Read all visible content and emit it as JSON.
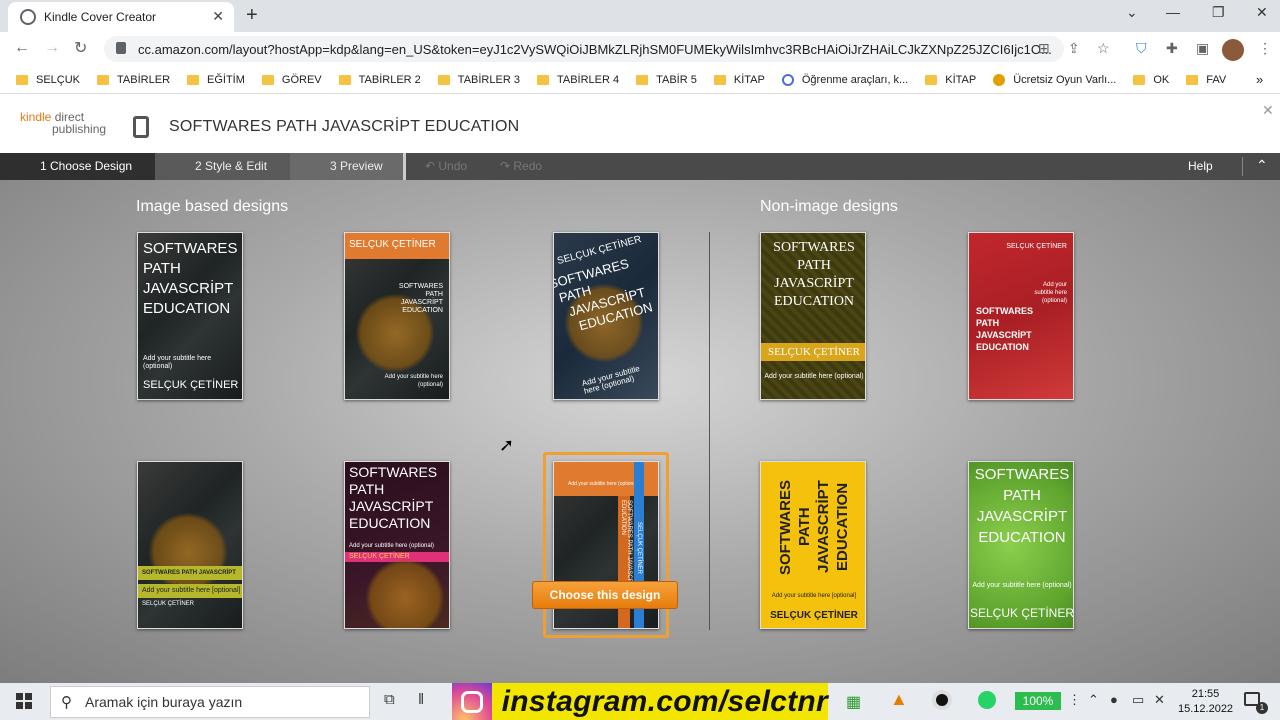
{
  "browser": {
    "tab_title": "Kindle Cover Creator",
    "url": "cc.amazon.com/layout?hostApp=kdp&lang=en_US&token=eyJ1c2VySWQiOiJBMkZLRjhSM0FUMEkyWilsImhvc3RBcHAiOiJrZHAiLCJkZXNpZ25JZCI6Ijc1O...",
    "bookmarks": [
      {
        "label": "SELÇUK",
        "icon": "folder-icon"
      },
      {
        "label": "TABİRLER",
        "icon": "folder-icon"
      },
      {
        "label": "EĞİTİM",
        "icon": "folder-icon"
      },
      {
        "label": "GÖREV",
        "icon": "folder-icon"
      },
      {
        "label": "TABİRLER 2",
        "icon": "folder-icon"
      },
      {
        "label": "TABİRLER 3",
        "icon": "folder-icon"
      },
      {
        "label": "TABİRLER 4",
        "icon": "folder-icon"
      },
      {
        "label": "TABİR 5",
        "icon": "folder-icon"
      },
      {
        "label": "KİTAP",
        "icon": "folder-icon"
      },
      {
        "label": "Öğrenme araçları, k...",
        "icon": "search-q-icon"
      },
      {
        "label": "KİTAP",
        "icon": "folder-icon"
      },
      {
        "label": "Ücretsiz Oyun Varlı...",
        "icon": "game-icon"
      },
      {
        "label": "OK",
        "icon": "folder-icon"
      },
      {
        "label": "FAV",
        "icon": "folder-icon"
      }
    ]
  },
  "header": {
    "logo_kindle": "kindle",
    "logo_direct": "direct",
    "logo_publishing": "publishing",
    "title": "SOFTWARES PATH JAVASCRİPT EDUCATION"
  },
  "steps": {
    "step1": "1 Choose Design",
    "step2": "2 Style & Edit",
    "step3": "3 Preview",
    "undo": "Undo",
    "redo": "Redo",
    "help": "Help"
  },
  "sections": {
    "image": "Image based designs",
    "nonimage": "Non-image designs"
  },
  "cover": {
    "title": "SOFTWARES PATH JAVASCRİPT EDUCATION",
    "title_lines": [
      "SOFTWARES",
      "PATH",
      "JAVASCRİPT",
      "EDUCATION"
    ],
    "title_short": "SOFTWARES PATH JAVASCRİPT EDUCATİON",
    "subtitle": "Add your subtitle here (optional)",
    "subtitle_brackets": "Add your subtitle here [optional]",
    "author": "SELÇUK ÇETİNER",
    "author_alt": "SELÇUK ÇETİNER"
  },
  "choose_button": "Choose this design",
  "taskbar": {
    "search_placeholder": "Aramak için buraya yazın",
    "instagram": "instagram.com/selctnr",
    "battery": "100%",
    "time": "21:55",
    "date": "15.12.2022",
    "notification_count": "1"
  },
  "colors": {
    "accent_orange": "#e47911",
    "select_border": "#f0a030"
  }
}
